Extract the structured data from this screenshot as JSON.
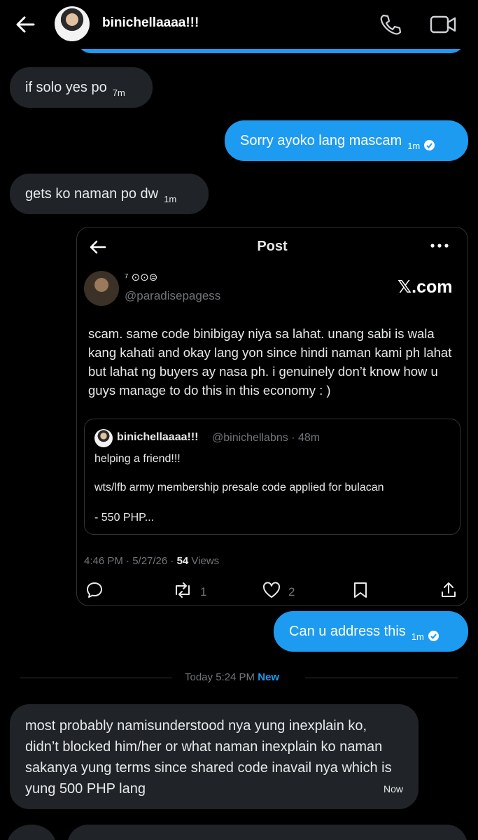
{
  "header": {
    "name": "binichellaaaa!!!"
  },
  "messages": [
    {
      "text": "if solo yes po",
      "time": "7m"
    },
    {
      "text": "Sorry ayoko lang mascam",
      "time": "1m"
    },
    {
      "text": "gets ko naman po dw",
      "time": "1m"
    }
  ],
  "post": {
    "title": "Post",
    "display_name": "⁷ ⊙⊙⊜",
    "handle": "@paradisepagess",
    "site": "𝕏.com",
    "text": "scam. same code binibigay niya sa lahat. unang sabi is wala kang kahati and okay lang yon since hindi naman kami ph lahat but lahat ng buyers ay nasa ph. i genuinely don’t know how u guys manage to do this in this economy : )",
    "quote": {
      "name": "binichellaaaa!!!",
      "handle_time": "@binichellabns · 48m",
      "line1": "helping a friend!!!",
      "line2": "wts/lfb army membership presale code applied for bulacan",
      "line3": "- 550 PHP..."
    },
    "meta_prefix": "4:46 PM · 5/27/26 · ",
    "views_count": "54",
    "views_label": " Views",
    "retweets": "1",
    "likes": "2"
  },
  "reply": {
    "text": "Can u address this",
    "time": "1m"
  },
  "divider": {
    "time_text": "Today 5:24 PM ",
    "new_label": "New"
  },
  "last_message": {
    "text": "most probably namisunderstood nya yung inexplain ko, didn’t blocked him/her or what naman inexplain ko naman sakanya yung terms since shared code inavail nya which is yung 500 PHP lang",
    "time": "Now"
  },
  "colors": {
    "accent": "#1d9bf0",
    "bubble_in": "#202327",
    "background": "#000000"
  },
  "icons": [
    "back-arrow-icon",
    "phone-icon",
    "video-icon",
    "more-icon",
    "reply-icon",
    "retweet-icon",
    "heart-icon",
    "bookmark-icon",
    "share-icon",
    "check-icon"
  ]
}
